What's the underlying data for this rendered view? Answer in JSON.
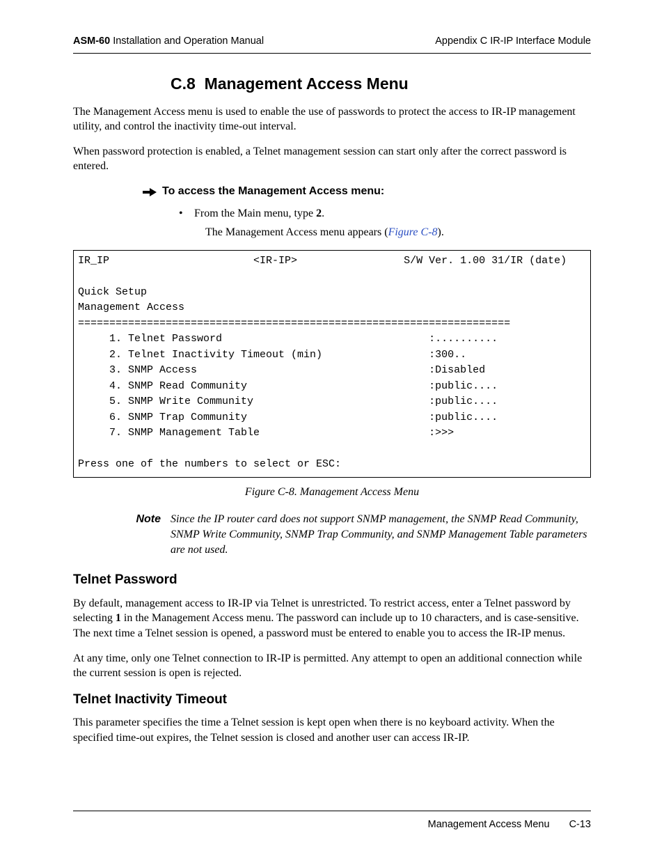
{
  "header": {
    "product": "ASM-60",
    "manual": " Installation and Operation Manual",
    "appendix": "Appendix C  IR-IP Interface Module"
  },
  "section": {
    "number": "C.8",
    "title": "Management Access Menu"
  },
  "intro": {
    "p1": "The Management Access menu is used to enable the use of passwords to protect the access to IR-IP management utility, and control the inactivity time-out interval.",
    "p2": "When password protection is enabled, a Telnet management session can start only after the correct password is entered."
  },
  "procedure": {
    "heading": "To access the Management Access menu:",
    "step_prefix": "From the Main menu, type ",
    "step_value": "2",
    "step_suffix": ".",
    "result_prefix": "The Management Access menu appears (",
    "figref": "Figure C-8",
    "result_suffix": ")."
  },
  "terminal": {
    "line1_left": "IR_IP",
    "line1_mid": "<IR-IP>",
    "line1_right": "S/W Ver. 1.00 31/IR (date)",
    "line2": "Quick Setup",
    "line3": "Management Access",
    "rule": "=====================================================================",
    "items": [
      {
        "n": "1",
        "label": "Telnet Password",
        "val": ":.........."
      },
      {
        "n": "2",
        "label": "Telnet Inactivity Timeout (min)",
        "val": ":300.."
      },
      {
        "n": "3",
        "label": "SNMP Access",
        "val": ":Disabled"
      },
      {
        "n": "4",
        "label": "SNMP Read Community",
        "val": ":public...."
      },
      {
        "n": "5",
        "label": "SNMP Write Community",
        "val": ":public...."
      },
      {
        "n": "6",
        "label": "SNMP Trap Community",
        "val": ":public...."
      },
      {
        "n": "7",
        "label": "SNMP Management Table",
        "val": ":>>>"
      }
    ],
    "prompt": "Press one of the numbers to select or ESC:"
  },
  "caption": "Figure C-8.  Management Access Menu",
  "note": {
    "label": "Note",
    "body": "Since the IP router card does not support SNMP management, the SNMP Read Community, SNMP Write Community, SNMP Trap Community, and SNMP Management Table parameters are not used."
  },
  "telnet_password": {
    "heading": "Telnet Password",
    "p1a": "By default, management access to IR-IP via Telnet is unrestricted. To restrict access, enter a Telnet password by selecting ",
    "p1b": "1",
    "p1c": " in the Management Access menu. The password can include up to 10 characters, and is case-sensitive. The next time a Telnet session is opened, a password must be entered to enable you to access the IR-IP menus.",
    "p2": "At any time, only one Telnet connection to IR-IP is permitted. Any attempt to open an additional connection while the current session is open is rejected."
  },
  "telnet_timeout": {
    "heading": "Telnet Inactivity Timeout",
    "p1": "This parameter specifies the time a Telnet session is kept open when there is no keyboard activity. When the specified time-out expires, the Telnet session is closed and another user can access IR-IP."
  },
  "footer": {
    "title": "Management Access Menu",
    "page": "C-13"
  }
}
